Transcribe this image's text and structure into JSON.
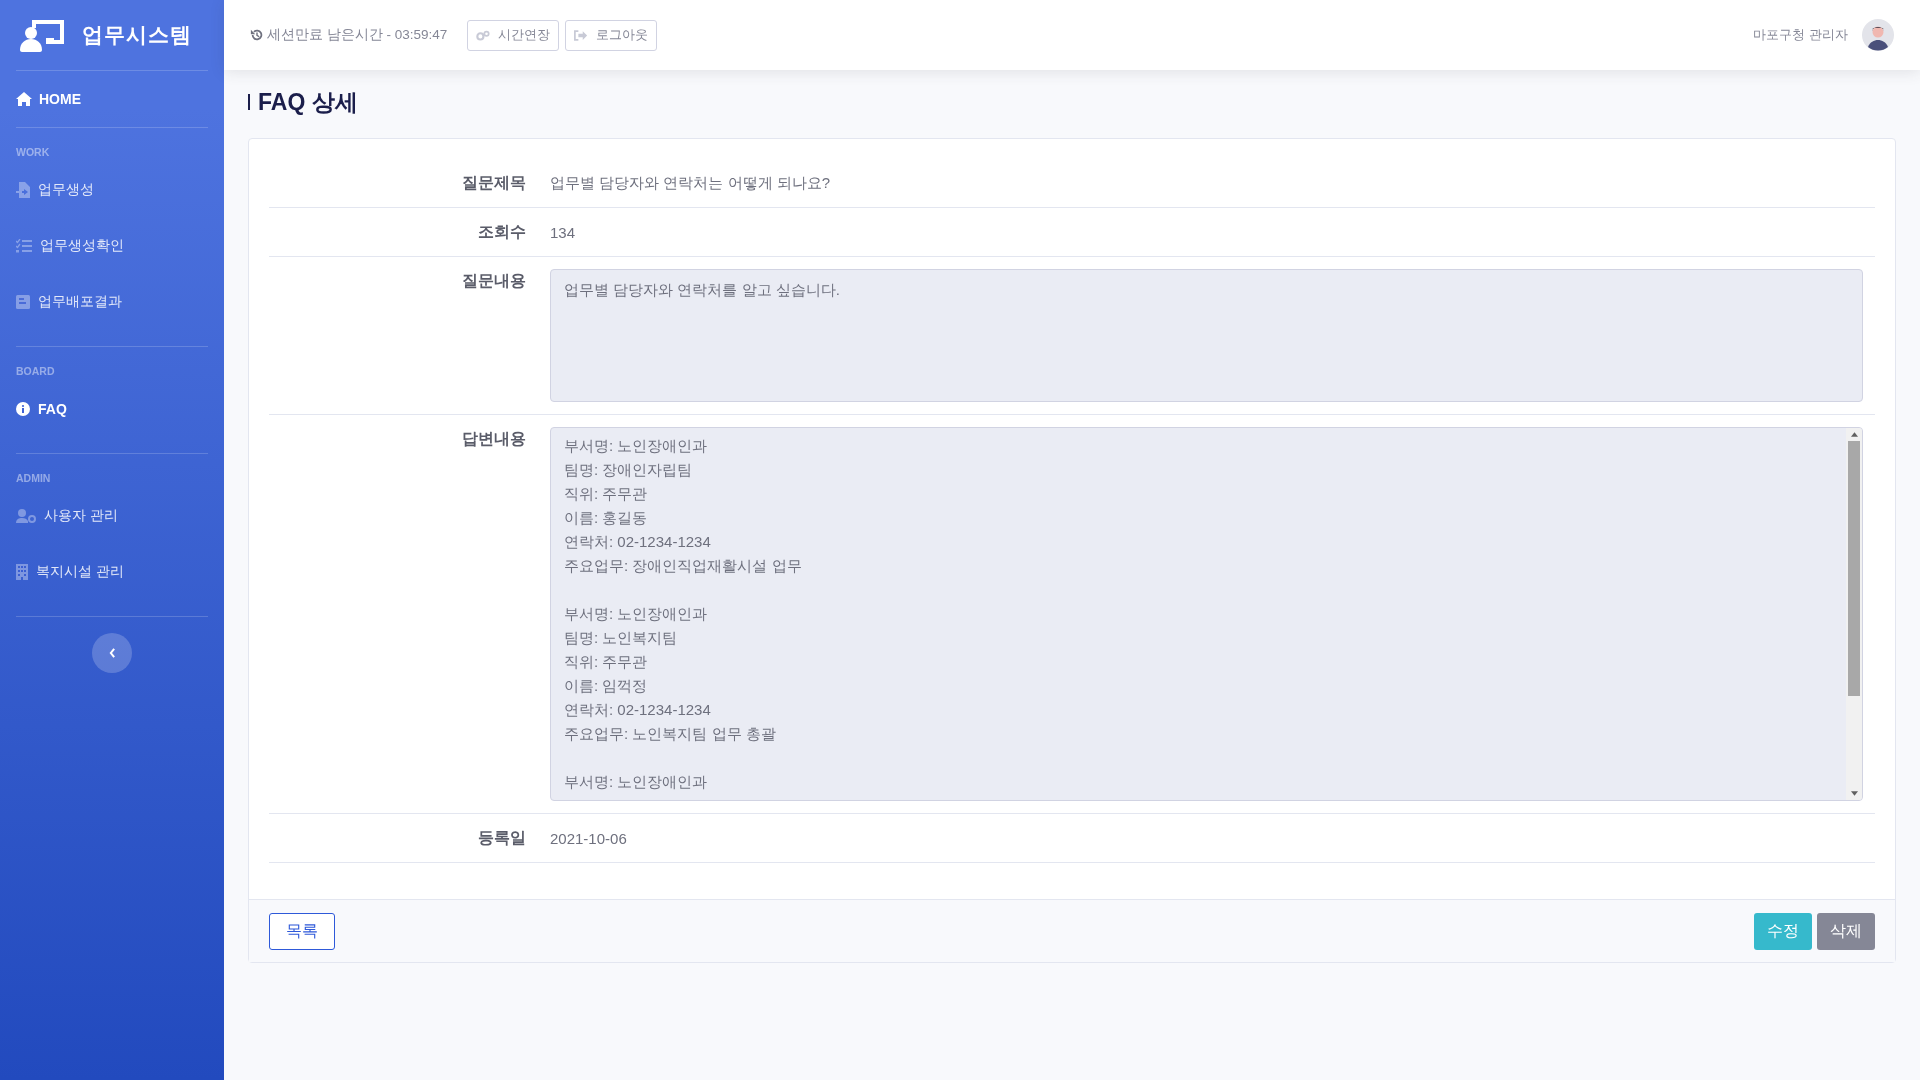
{
  "sidebar": {
    "brand": "업무시스템",
    "home": "HOME",
    "sections": [
      {
        "heading": "WORK",
        "items": [
          {
            "label": "업무생성",
            "kind": "file",
            "selected": false
          },
          {
            "label": "업무생성확인",
            "kind": "list",
            "selected": false
          },
          {
            "label": "업무배포결과",
            "kind": "doc",
            "selected": false
          }
        ]
      },
      {
        "heading": "BOARD",
        "items": [
          {
            "label": "FAQ",
            "kind": "info",
            "selected": true
          }
        ]
      },
      {
        "heading": "ADMIN",
        "items": [
          {
            "label": "사용자 관리",
            "kind": "user",
            "selected": false
          },
          {
            "label": "복지시설 관리",
            "kind": "building",
            "selected": false
          }
        ]
      }
    ]
  },
  "topbar": {
    "session": "세션만료 남은시간 - 03:59:47",
    "buttons": [
      {
        "label": "시간연장",
        "kind": "extend"
      },
      {
        "label": "로그아웃",
        "kind": "logout"
      }
    ],
    "user": "마포구청 관리자"
  },
  "page_title": "FAQ 상세",
  "fields": [
    {
      "kind": "text",
      "label": "질문제목",
      "value": "업무별 담당자와 연락처는 어떻게 되나요?"
    },
    {
      "kind": "text",
      "label": "조회수",
      "value": "134"
    },
    {
      "kind": "area",
      "label": "질문내용",
      "blocks": [
        [
          "업무별 담당자와 연락처를 알고 싶습니다."
        ]
      ]
    },
    {
      "kind": "scroll",
      "label": "답변내용",
      "blocks": [
        [
          "부서명: 노인장애인과",
          "팀명: 장애인자립팀",
          "직위: 주무관",
          "이름: 홍길동",
          "연락처: 02-1234-1234",
          "주요업무: 장애인직업재활시설 업무"
        ],
        [
          "부서명: 노인장애인과",
          "팀명:  노인복지팀",
          "직위: 주무관",
          "이름:  임꺽정",
          "연락처: 02-1234-1234",
          "주요업무: 노인복지팀 업무 총괄"
        ],
        [
          "부서명: 노인장애인과"
        ]
      ]
    },
    {
      "kind": "text",
      "label": "등록일",
      "value": "2021-10-06"
    }
  ],
  "footer": {
    "list_button": "목록",
    "actions": [
      {
        "label": "수정",
        "kind": "edit"
      },
      {
        "label": "삭제",
        "kind": "delete"
      }
    ]
  }
}
